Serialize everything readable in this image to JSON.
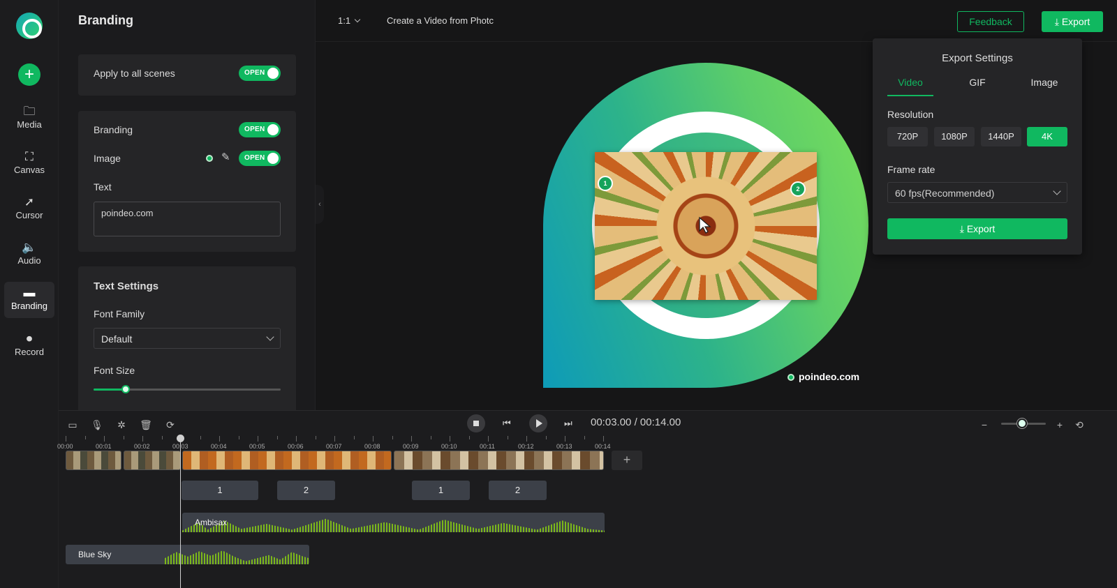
{
  "sidebar": {
    "items": [
      {
        "icon": "media-icon",
        "label": "Media",
        "glyph": "🗀"
      },
      {
        "icon": "canvas-icon",
        "label": "Canvas",
        "glyph": "⛶"
      },
      {
        "icon": "cursor-icon",
        "label": "Cursor",
        "glyph": "➚"
      },
      {
        "icon": "audio-icon",
        "label": "Audio",
        "glyph": "🔈"
      },
      {
        "icon": "branding-icon",
        "label": "Branding",
        "glyph": "▬"
      },
      {
        "icon": "record-icon",
        "label": "Record",
        "glyph": "⏺"
      }
    ],
    "add_glyph": "+"
  },
  "panel": {
    "title": "Branding",
    "apply_all_label": "Apply to all scenes",
    "branding_label": "Branding",
    "image_label": "Image",
    "text_label": "Text",
    "text_value": "poindeo.com",
    "toggle_open": "OPEN",
    "text_settings_title": "Text Settings",
    "font_family_label": "Font Family",
    "font_family_value": "Default",
    "font_size_label": "Font Size",
    "font_size_level": 0.17,
    "edit_glyph": "✎"
  },
  "topbar": {
    "aspect_ratio": "1:1",
    "doc_title": "Create a Video from Photc",
    "feedback_label": "Feedback",
    "export_label": "Export",
    "download_glyph": "⤓"
  },
  "preview": {
    "marker_1": "1",
    "marker_2": "2",
    "watermark_text": "poindeo.com"
  },
  "export_popup": {
    "title": "Export Settings",
    "tabs": [
      "Video",
      "GIF",
      "Image"
    ],
    "active_tab": "Video",
    "resolution_label": "Resolution",
    "resolutions": [
      "720P",
      "1080P",
      "1440P",
      "4K"
    ],
    "active_resolution": "4K",
    "frame_rate_label": "Frame rate",
    "frame_rate_value": "60 fps(Recommended)",
    "export_label": "Export"
  },
  "timeline": {
    "current_time": "00:03.00",
    "separator": "/",
    "total_time": "00:14.00",
    "ticks": [
      "00:00",
      "00:01",
      "00:02",
      "00:03",
      "00:04",
      "00:05",
      "00:06",
      "00:07",
      "00:08",
      "00:09",
      "00:10",
      "00:11",
      "00:12",
      "00:13",
      "00:14"
    ],
    "markers": [
      "1",
      "2",
      "1",
      "2"
    ],
    "audio_tracks": [
      "Ambisax",
      "Blue Sky"
    ],
    "zoom_level": 0.47,
    "add_glyph": "+"
  },
  "colors": {
    "accent": "#10b860",
    "background": "#161617",
    "panel": "#1b1b1d",
    "card": "#252527"
  }
}
